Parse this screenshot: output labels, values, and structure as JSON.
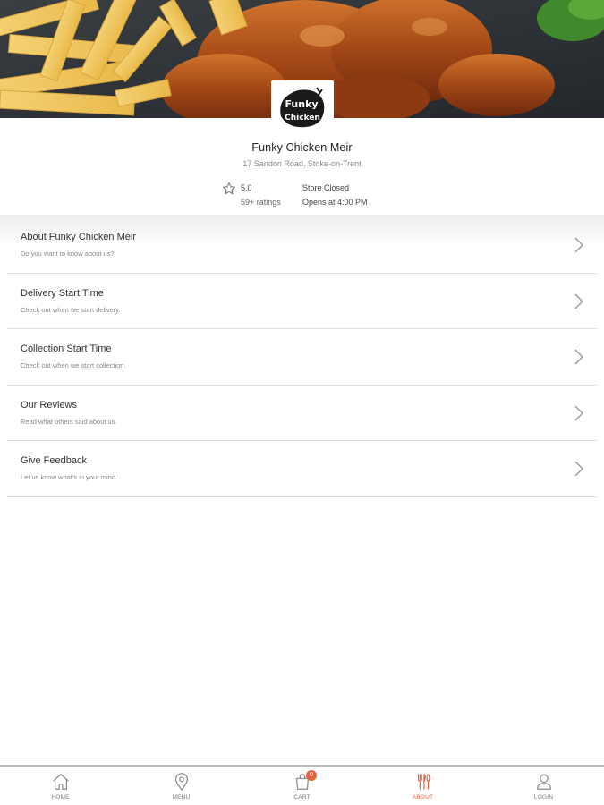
{
  "store": {
    "name": "Funky Chicken Meir",
    "address": "17 Sandon Road, Stoke-on-Trent",
    "rating": "5.0",
    "ratings_count": "59+ ratings",
    "status": "Store Closed",
    "opens": "Opens at 4:00 PM",
    "logo_text": "Funky Chicken"
  },
  "menu_items": [
    {
      "title": "About Funky Chicken Meir",
      "subtitle": "Do you want to know about us?"
    },
    {
      "title": "Delivery Start Time",
      "subtitle": "Check out when we start delivery."
    },
    {
      "title": "Collection Start Time",
      "subtitle": "Check out when we start collection."
    },
    {
      "title": "Our Reviews",
      "subtitle": "Read what others said about us."
    },
    {
      "title": "Give Feedback",
      "subtitle": "Let us know what's in your mind."
    }
  ],
  "tabs": [
    {
      "label": "HOME",
      "icon": "home-icon"
    },
    {
      "label": "MENU",
      "icon": "location-pin-icon"
    },
    {
      "label": "CART",
      "icon": "shopping-bag-icon",
      "badge": "0"
    },
    {
      "label": "ABOUT",
      "icon": "cutlery-icon",
      "active": true
    },
    {
      "label": "LOGIN",
      "icon": "user-icon"
    }
  ],
  "colors": {
    "accent": "#e8623f",
    "divider": "#e2e2e2",
    "tabbar_border": "#b9b9b9"
  }
}
